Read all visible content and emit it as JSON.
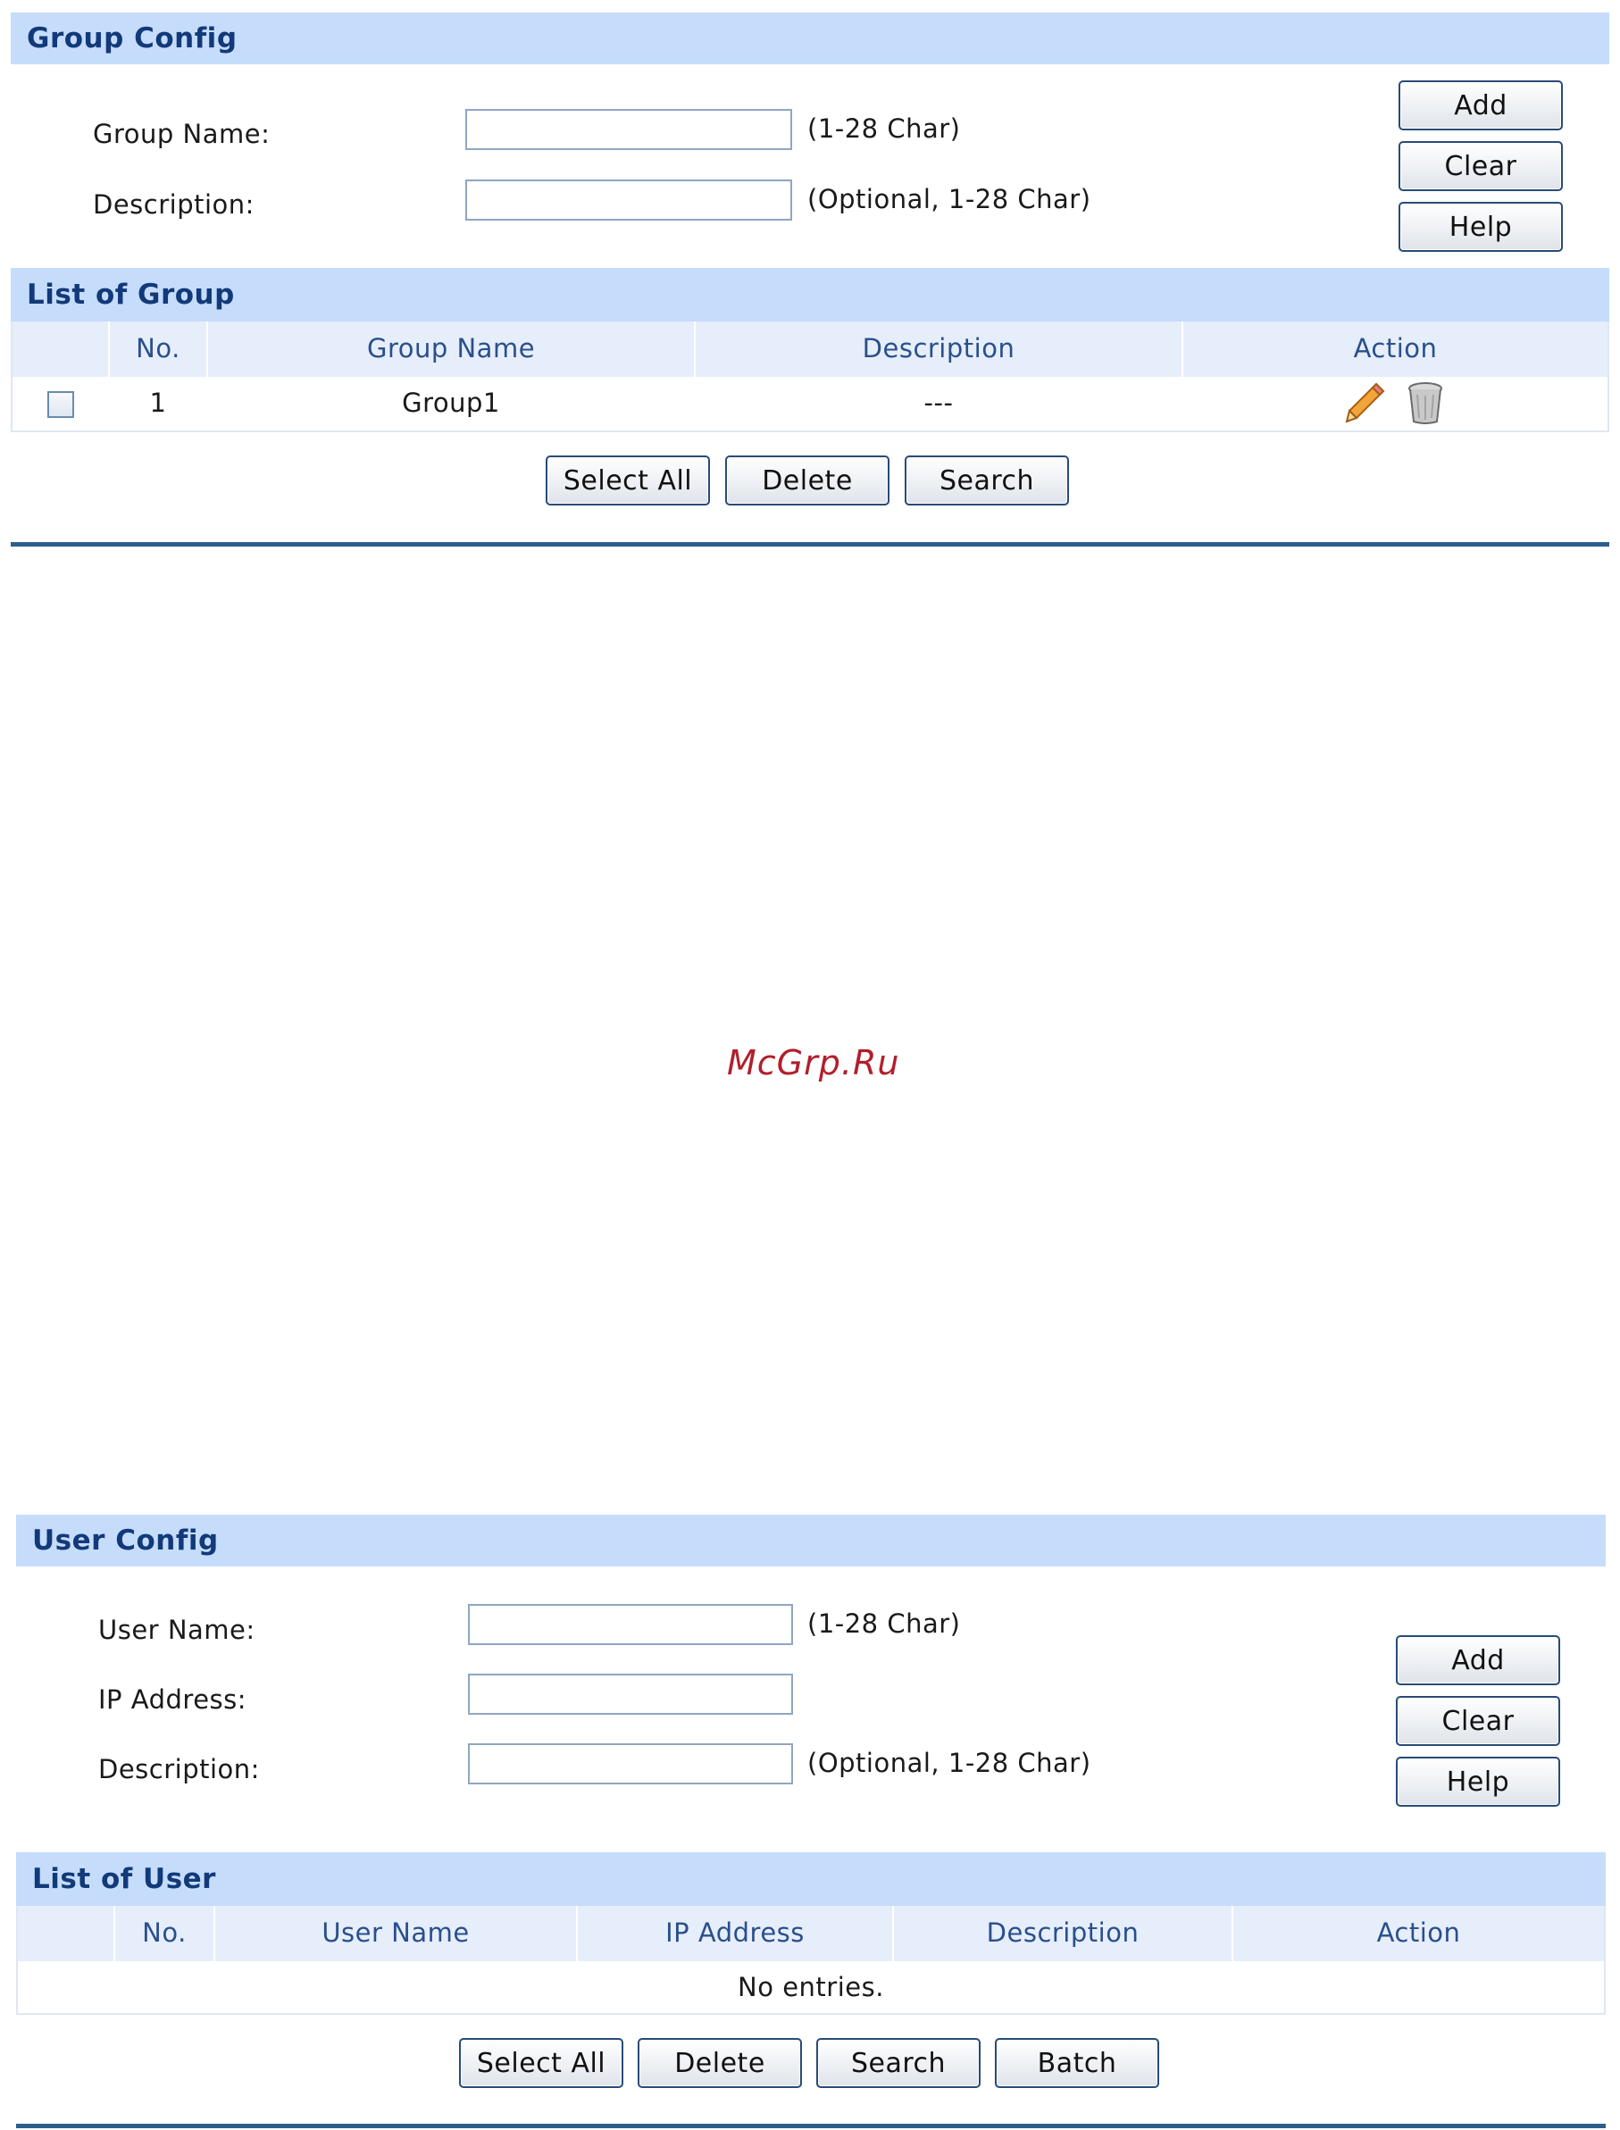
{
  "group_config": {
    "title": "Group Config",
    "group_name_label": "Group Name:",
    "group_name_value": "",
    "group_name_hint": "(1-28 Char)",
    "description_label": "Description:",
    "description_value": "",
    "description_hint": "(Optional, 1-28 Char)",
    "add_label": "Add",
    "clear_label": "Clear",
    "help_label": "Help"
  },
  "group_list": {
    "title": "List of Group",
    "columns": [
      "",
      "No.",
      "Group Name",
      "Description",
      "Action"
    ],
    "rows": [
      {
        "no": "1",
        "name": "Group1",
        "description": "---"
      }
    ],
    "select_all_label": "Select All",
    "delete_label": "Delete",
    "search_label": "Search"
  },
  "watermark": "McGrp.Ru",
  "user_config": {
    "title": "User Config",
    "user_name_label": "User Name:",
    "user_name_value": "",
    "user_name_hint": "(1-28 Char)",
    "ip_label": "IP Address:",
    "ip_value": "",
    "description_label": "Description:",
    "description_value": "",
    "description_hint": "(Optional, 1-28 Char)",
    "add_label": "Add",
    "clear_label": "Clear",
    "help_label": "Help"
  },
  "user_list": {
    "title": "List of User",
    "columns": [
      "",
      "No.",
      "User Name",
      "IP Address",
      "Description",
      "Action"
    ],
    "empty_text": "No entries.",
    "select_all_label": "Select All",
    "delete_label": "Delete",
    "search_label": "Search",
    "batch_label": "Batch"
  },
  "icons": {
    "edit": "pencil-edit-icon",
    "delete": "trash-bin-icon"
  },
  "colors": {
    "header_bg": "#c6dcfb",
    "header_text": "#123a7a",
    "column_header_bg": "#e6eefb",
    "divider": "#2b5e8c",
    "watermark": "#b21e2b"
  }
}
